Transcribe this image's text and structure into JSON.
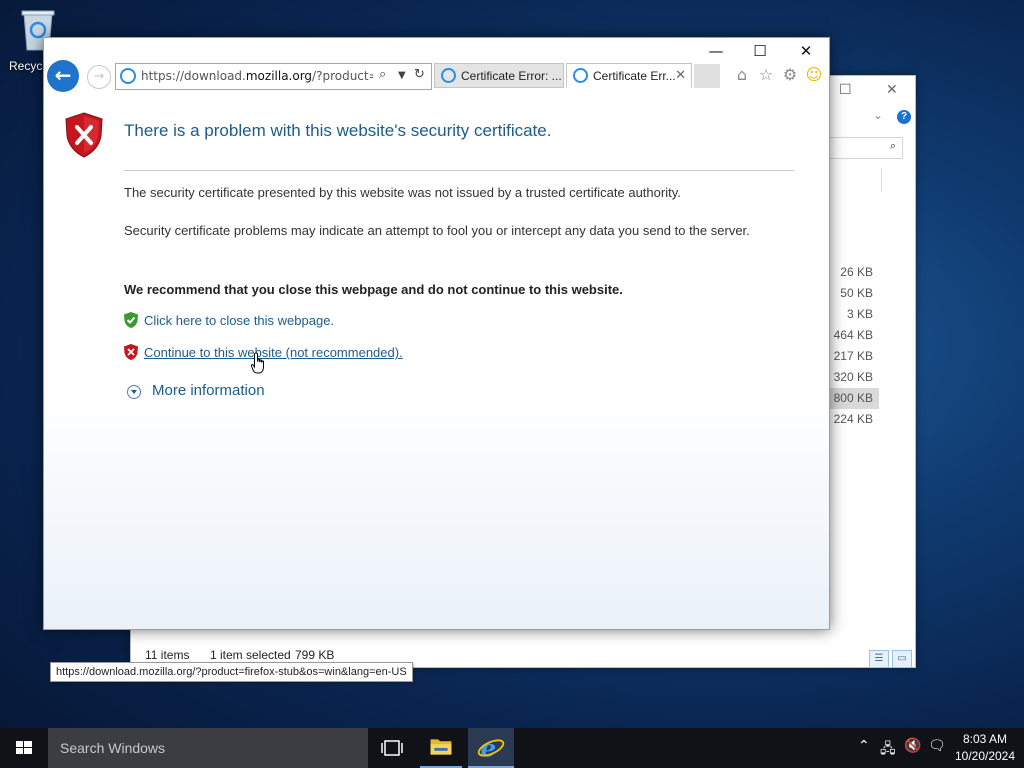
{
  "desktop": {
    "recycle_label": "Recycl"
  },
  "explorer": {
    "search_placeholder": "r",
    "sizes": [
      "26 KB",
      "50 KB",
      "3 KB",
      "464 KB",
      "217 KB",
      "320 KB",
      "800 KB",
      "224 KB"
    ],
    "selected_index": 6,
    "status_items": "11 items",
    "status_selected": "1 item selected",
    "status_size": "799 KB"
  },
  "browser": {
    "url_prefix": "https://download.",
    "url_domain": "mozilla.org",
    "url_suffix": "/?product=firef",
    "tabs": [
      {
        "label": "Certificate Error: ...",
        "active": false
      },
      {
        "label": "Certificate Err...",
        "active": true
      }
    ],
    "status_url": "https://download.mozilla.org/?product=firefox-stub&os=win&lang=en-US"
  },
  "page": {
    "title": "There is a problem with this website's security certificate.",
    "paragraph1": "The security certificate presented by this website was not issued by a trusted certificate authority.",
    "paragraph2": "Security certificate problems may indicate an attempt to fool you or intercept any data you send to the server.",
    "recommendation": "We recommend that you close this webpage and do not continue to this website.",
    "close_link": "Click here to close this webpage.",
    "continue_link": "Continue to this website (not recommended).",
    "more_info": "More information"
  },
  "taskbar": {
    "search_placeholder": "Search Windows",
    "time": "8:03 AM",
    "date": "10/20/2024"
  },
  "colors": {
    "link": "#1b5c8d",
    "shield_red": "#c4161c",
    "shield_green": "#3a9a2e",
    "accent": "#1f74c9"
  }
}
